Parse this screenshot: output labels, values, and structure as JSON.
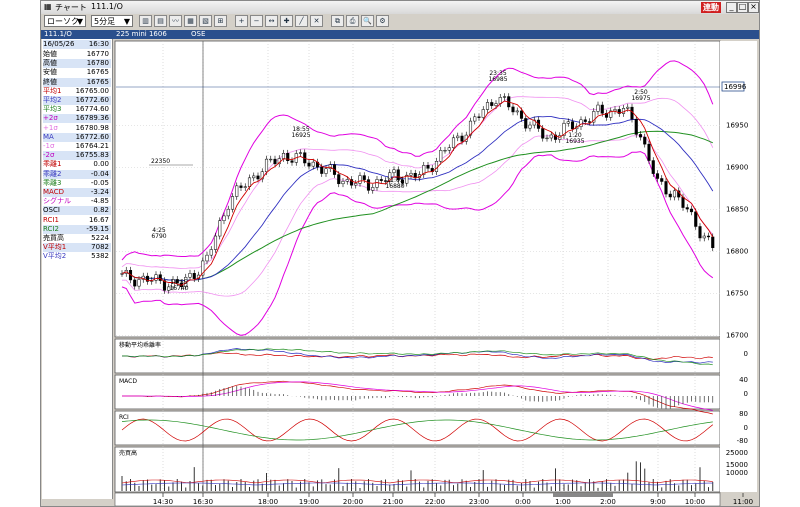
{
  "window": {
    "title": "チャート",
    "symbol_title": "111.1/O",
    "live_label": "連動",
    "controls": [
      "_",
      "□",
      "×"
    ]
  },
  "toolbar": {
    "chart_type": "ローソク",
    "interval": "5分足",
    "icons": [
      "candle-icon",
      "bar-icon",
      "line-icon",
      "point-figure-icon",
      "renko-icon",
      "compare-icon",
      "zoom-in-icon",
      "zoom-out-icon",
      "scroll-icon",
      "cross-icon",
      "trend-icon",
      "delete-icon",
      "copy-icon",
      "print-icon",
      "search-icon",
      "settings-icon"
    ]
  },
  "infobar": {
    "symbol": "111.1/O",
    "contract": "225 mini 1606",
    "exchange": "OSE"
  },
  "panel": {
    "date": "16/05/26",
    "time": "16:30",
    "rows": [
      {
        "label": "始値",
        "value": "16770",
        "color": "#000"
      },
      {
        "label": "高値",
        "value": "16780",
        "color": "#000"
      },
      {
        "label": "安値",
        "value": "16765",
        "color": "#000"
      },
      {
        "label": "終値",
        "value": "16765",
        "color": "#000"
      },
      {
        "label": "平均1",
        "value": "16765.00",
        "color": "#c00000"
      },
      {
        "label": "平均2",
        "value": "16772.60",
        "color": "#3a3ac0"
      },
      {
        "label": "平均3",
        "value": "16774.60",
        "color": "#208020"
      },
      {
        "label": "+2σ",
        "value": "16789.36",
        "color": "#c000c0"
      },
      {
        "label": "+1σ",
        "value": "16780.98",
        "color": "#e070e0"
      },
      {
        "label": "MA",
        "value": "16772.60",
        "color": "#3a3ac0"
      },
      {
        "label": "-1σ",
        "value": "16764.21",
        "color": "#e070e0"
      },
      {
        "label": "-2σ",
        "value": "16755.83",
        "color": "#c000c0"
      },
      {
        "label": "乖離1",
        "value": "0.00",
        "color": "#c00000"
      },
      {
        "label": "乖離2",
        "value": "-0.04",
        "color": "#3a3ac0"
      },
      {
        "label": "乖離3",
        "value": "-0.05",
        "color": "#208020"
      },
      {
        "label": "MACD",
        "value": "-3.24",
        "color": "#c00000"
      },
      {
        "label": "シグナル",
        "value": "-4.85",
        "color": "#c000c0"
      },
      {
        "label": "OSCI",
        "value": "0.82",
        "color": "#000"
      },
      {
        "label": "RCI1",
        "value": "16.67",
        "color": "#c00000"
      },
      {
        "label": "RCI2",
        "value": "-59.15",
        "color": "#208020"
      },
      {
        "label": "売買高",
        "value": "5224",
        "color": "#000"
      },
      {
        "label": "V平均1",
        "value": "7082",
        "color": "#c00000"
      },
      {
        "label": "V平均2",
        "value": "5382",
        "color": "#3a3ac0"
      }
    ]
  },
  "chart": {
    "price_labels": [
      "16950",
      "16900",
      "16850",
      "16800",
      "16750",
      "16700"
    ],
    "current_price": "16996",
    "marker_price": "22350",
    "annotations": [
      {
        "time": "4:25",
        "price": "6790"
      },
      {
        "time": "14:55",
        "price": "16740"
      },
      {
        "time": "18:55",
        "price": "16925"
      },
      {
        "time": "21:05",
        "price": "16880"
      },
      {
        "time": "23:35",
        "price": "16985"
      },
      {
        "time": "1:20",
        "price": "16935"
      },
      {
        "time": "2:50",
        "price": "16975"
      }
    ],
    "time_labels": [
      "14:30",
      "16:30",
      "18:00",
      "19:00",
      "20:00",
      "21:00",
      "22:00",
      "23:00",
      "0:00",
      "1:00",
      "2:00",
      "9:00",
      "10:00",
      "11:00"
    ],
    "subcharts": [
      {
        "title": "移動平均乖離率",
        "labels": [
          "0"
        ]
      },
      {
        "title": "MACD",
        "labels": [
          "40",
          "0"
        ]
      },
      {
        "title": "RCI",
        "labels": [
          "80",
          "0",
          "-80"
        ]
      },
      {
        "title": "売買高",
        "labels": [
          "25000",
          "15000",
          "10000"
        ]
      }
    ],
    "colors": {
      "ma1": "#d00000",
      "ma2": "#3030c0",
      "ma3": "#209020",
      "bb2": "#e000e0",
      "bb1": "#f090f0",
      "bg": "#ffffff"
    }
  }
}
